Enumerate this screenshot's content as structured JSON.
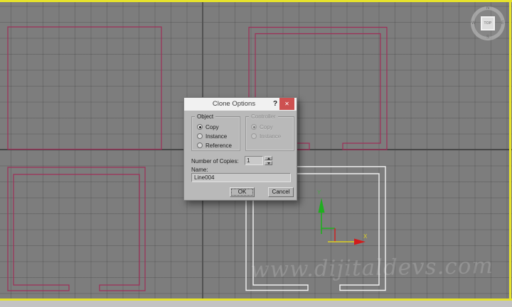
{
  "viewport": {
    "watermark_text": "www.dijitaldevs.com",
    "viewcube": {
      "face_label": "TOP",
      "n": "N",
      "s": "S",
      "e": "E",
      "w": "W"
    },
    "gizmo": {
      "x_label": "X",
      "y_label": "Y"
    }
  },
  "dialog": {
    "title": "Clone Options",
    "help_button": "?",
    "close_button": "✕",
    "object_group": {
      "label": "Object",
      "options": [
        {
          "label": "Copy",
          "selected": true
        },
        {
          "label": "Instance",
          "selected": false
        },
        {
          "label": "Reference",
          "selected": false
        }
      ]
    },
    "controller_group": {
      "label": "Controller",
      "disabled": true,
      "options": [
        {
          "label": "Copy",
          "selected": true
        },
        {
          "label": "Instance",
          "selected": false
        }
      ]
    },
    "copies_label": "Number of Copies:",
    "copies_value": "1",
    "name_label": "Name:",
    "name_value": "Line004",
    "ok_label": "OK",
    "cancel_label": "Cancel"
  },
  "colors": {
    "viewport_bg": "#7d7d7d",
    "grid_line": "#6f6f6f",
    "origin_line": "#464646",
    "active_viewport_border": "#e6e22b",
    "spline_red": "#9e2f58",
    "selected_spline_white": "#f2f2f2",
    "axis_x_red": "#d11c1c",
    "axis_y_green": "#1fae1f",
    "axis_highlight_yellow": "#ddd020",
    "dialog_close_red": "#cd5151"
  }
}
